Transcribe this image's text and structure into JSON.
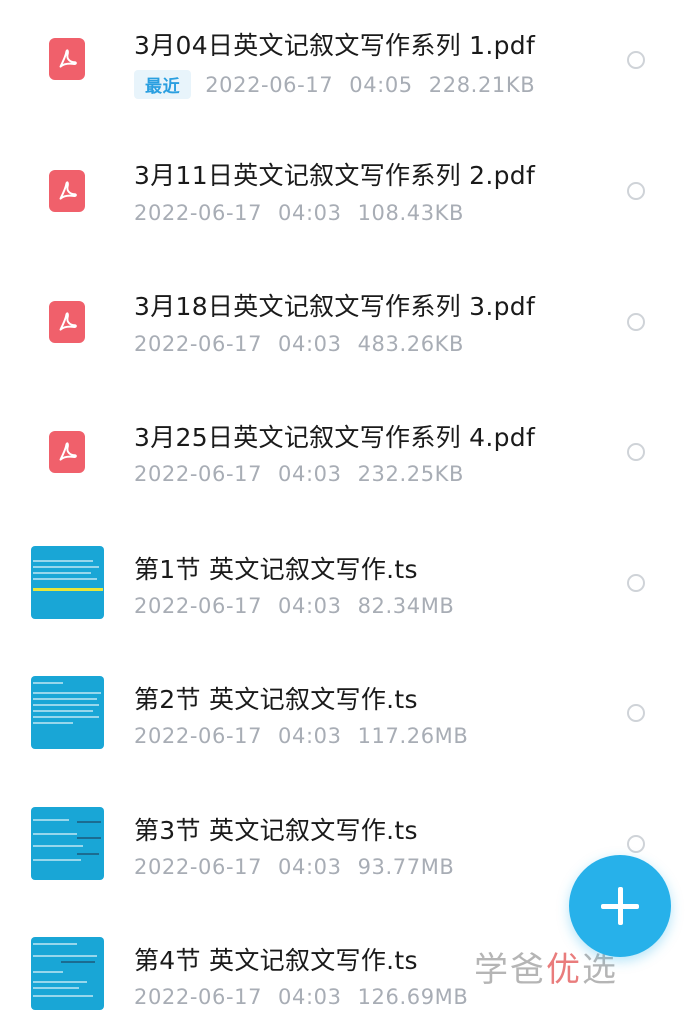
{
  "files": [
    {
      "name": "3月04日英文记叙文写作系列 1.pdf",
      "type": "pdf",
      "tag": "最近",
      "date": "2022-06-17",
      "time": "04:05",
      "size": "228.21KB"
    },
    {
      "name": "3月11日英文记叙文写作系列 2.pdf",
      "type": "pdf",
      "tag": "",
      "date": "2022-06-17",
      "time": "04:03",
      "size": "108.43KB"
    },
    {
      "name": "3月18日英文记叙文写作系列 3.pdf",
      "type": "pdf",
      "tag": "",
      "date": "2022-06-17",
      "time": "04:03",
      "size": "483.26KB"
    },
    {
      "name": "3月25日英文记叙文写作系列 4.pdf",
      "type": "pdf",
      "tag": "",
      "date": "2022-06-17",
      "time": "04:03",
      "size": "232.25KB"
    },
    {
      "name": "第1节 英文记叙文写作.ts",
      "type": "video",
      "tag": "",
      "date": "2022-06-17",
      "time": "04:03",
      "size": "82.34MB"
    },
    {
      "name": "第2节 英文记叙文写作.ts",
      "type": "video",
      "tag": "",
      "date": "2022-06-17",
      "time": "04:03",
      "size": "117.26MB"
    },
    {
      "name": "第3节 英文记叙文写作.ts",
      "type": "video",
      "tag": "",
      "date": "2022-06-17",
      "time": "04:03",
      "size": "93.77MB"
    },
    {
      "name": "第4节 英文记叙文写作.ts",
      "type": "video",
      "tag": "",
      "date": "2022-06-17",
      "time": "04:03",
      "size": "126.69MB"
    }
  ],
  "icons": {
    "pdf": "pdf-file-icon",
    "video": "video-thumbnail",
    "select": "radio-circle-icon",
    "fab": "plus-icon"
  },
  "colors": {
    "pdf_icon": "#f0606b",
    "video_thumb": "#19a6d6",
    "fab": "#27b1ea",
    "tag_text": "#2a9fe0",
    "meta_text": "#a8adb5"
  },
  "watermark": {
    "part1": "学爸",
    "part2": "优",
    "part3": "选"
  }
}
